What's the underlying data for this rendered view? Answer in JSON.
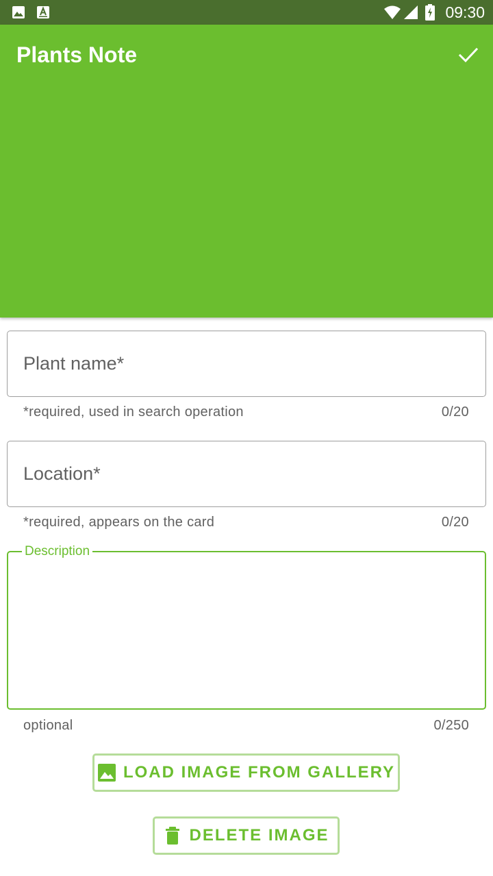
{
  "status_bar": {
    "time": "09:30",
    "icons": [
      "image-notification-icon",
      "font-notification-icon",
      "wifi-icon",
      "signal-icon",
      "battery-charging-icon"
    ]
  },
  "app_bar": {
    "title": "Plants Note",
    "confirm_icon": "check-icon",
    "color": "#6bbe2f"
  },
  "form": {
    "plant_name": {
      "label": "Plant name*",
      "value": "",
      "helper": "*required, used in search operation",
      "counter": "0/20"
    },
    "location": {
      "label": "Location*",
      "value": "",
      "helper": "*required, appears on the card",
      "counter": "0/20"
    },
    "description": {
      "label": "Description",
      "value": "",
      "helper": "optional",
      "counter": "0/250"
    }
  },
  "buttons": {
    "load_image": {
      "label": "LOAD IMAGE FROM GALLERY",
      "icon": "image-icon"
    },
    "delete_image": {
      "label": "DELETE IMAGE",
      "icon": "trash-icon"
    }
  },
  "colors": {
    "accent": "#6bbe2f",
    "status_bar": "#4a6e2e",
    "button_border": "#b5dc99"
  }
}
